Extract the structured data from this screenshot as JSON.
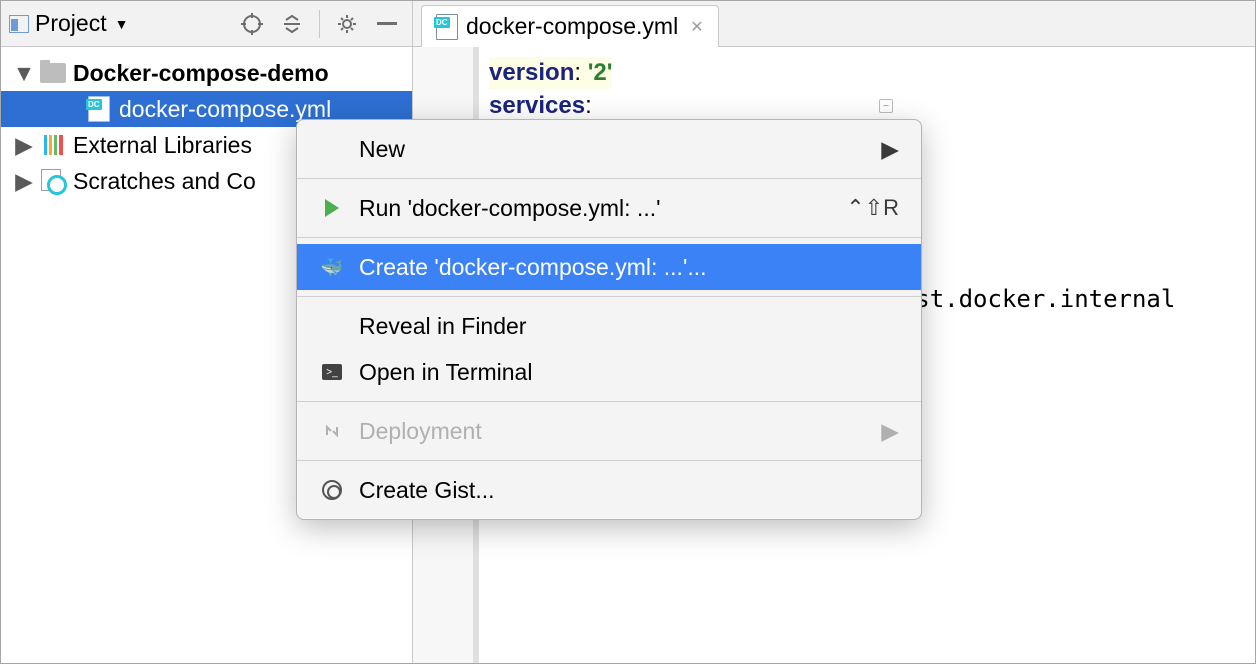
{
  "sidebar": {
    "title": "Project",
    "tree": {
      "root": "Docker-compose-demo",
      "file": "docker-compose.yml",
      "ext_libs": "External Libraries",
      "scratches": "Scratches and Co"
    }
  },
  "tab": {
    "label": "docker-compose.yml"
  },
  "code": {
    "k_version": "version",
    "v_version": "'2'",
    "k_services": "services",
    "extra": "st=host.docker.internal"
  },
  "menu": {
    "new": "New",
    "run": "Run 'docker-compose.yml: ...'",
    "run_shortcut": "⌃⇧R",
    "create": "Create 'docker-compose.yml: ...'...",
    "reveal": "Reveal in Finder",
    "terminal": "Open in Terminal",
    "deploy": "Deployment",
    "gist": "Create Gist..."
  }
}
